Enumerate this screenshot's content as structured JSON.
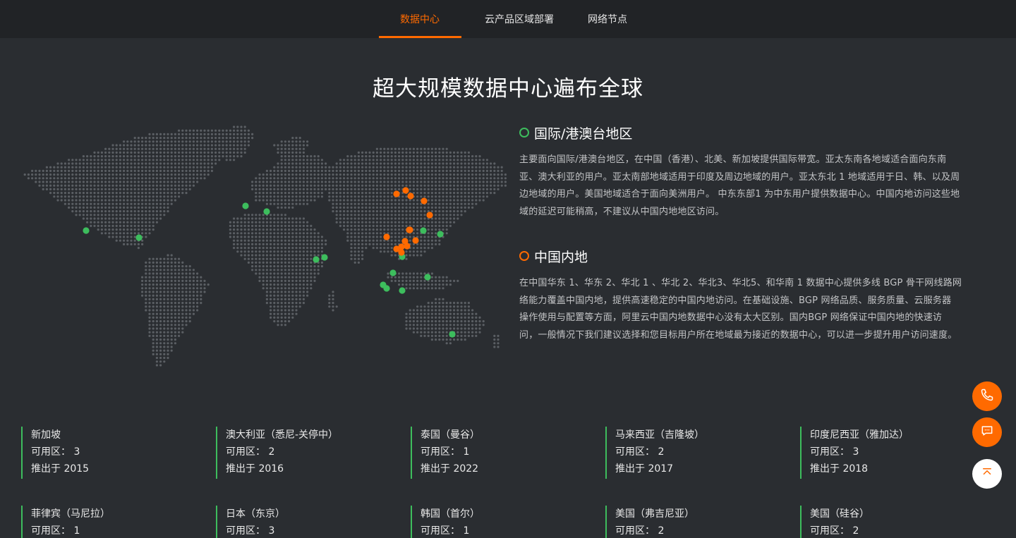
{
  "nav": {
    "tabs": [
      {
        "label": "数据中心",
        "active": true
      },
      {
        "label": "云产品区域部署",
        "active": false
      },
      {
        "label": "网络节点",
        "active": false
      }
    ]
  },
  "page_title": "超大规模数据中心遍布全球",
  "regions": [
    {
      "title": "国际/港澳台地区",
      "marker_color": "#3dbd5d",
      "lines": [
        "主要面向国际/港澳台地区，在中国（香港）、北美、新加坡提供国际带宽。亚太东南各地域适合面向东南",
        "亚、澳大利亚的用户。亚太南部地域适用于印度及周边地域的用户。亚太东北 1 地域适用于日、韩、以及周",
        "边地域的用户。美国地域适合于面向美洲用户。 中东东部1 为中东用户提供数据中心。中国内地访问这些地",
        "域的延迟可能稍高，不建议从中国内地地区访问。"
      ]
    },
    {
      "title": "中国内地",
      "marker_color": "#ff6a00",
      "lines": [
        "在中国华东 1、华东 2、华北 1 、华北 2、华北3、华北5、和华南 1 数据中心提供多线 BGP 骨干网线路网",
        "络能力覆盖中国内地，提供高速稳定的中国内地访问。在基础设施、BGP 网络品质、服务质量、云服务器",
        "操作使用与配置等方面，阿里云中国内地数据中心没有太大区别。国内BGP 网络保证中国内地的快速访",
        "问，一般情况下我们建议选择和您目标用户所在地域最为接近的数据中心，可以进一步提升用户访问速度。"
      ]
    }
  ],
  "datacenters": [
    {
      "name": "新加坡",
      "zones": "可用区： 3",
      "since": "推出于 2015"
    },
    {
      "name": "澳大利亚（悉尼-关停中）",
      "zones": "可用区： 2",
      "since": "推出于 2016"
    },
    {
      "name": "泰国（曼谷）",
      "zones": "可用区： 1",
      "since": "推出于 2022"
    },
    {
      "name": "马来西亚（吉隆坡）",
      "zones": "可用区： 2",
      "since": "推出于 2017"
    },
    {
      "name": "印度尼西亚（雅加达）",
      "zones": "可用区： 3",
      "since": "推出于 2018"
    },
    {
      "name": "菲律宾（马尼拉）",
      "zones": "可用区： 1",
      "since": ""
    },
    {
      "name": "日本（东京）",
      "zones": "可用区： 3",
      "since": ""
    },
    {
      "name": "韩国（首尔）",
      "zones": "可用区： 1",
      "since": ""
    },
    {
      "name": "美国（弗吉尼亚）",
      "zones": "可用区： 2",
      "since": ""
    },
    {
      "name": "美国（硅谷）",
      "zones": "可用区： 2",
      "since": ""
    }
  ],
  "colors": {
    "accent": "#ff6a00",
    "international": "#3dbd5d",
    "background": "#2a2d31",
    "nav": "#212326"
  },
  "floating_buttons": [
    {
      "icon": "phone-icon"
    },
    {
      "icon": "chat-icon"
    },
    {
      "icon": "back-to-top-icon"
    }
  ]
}
